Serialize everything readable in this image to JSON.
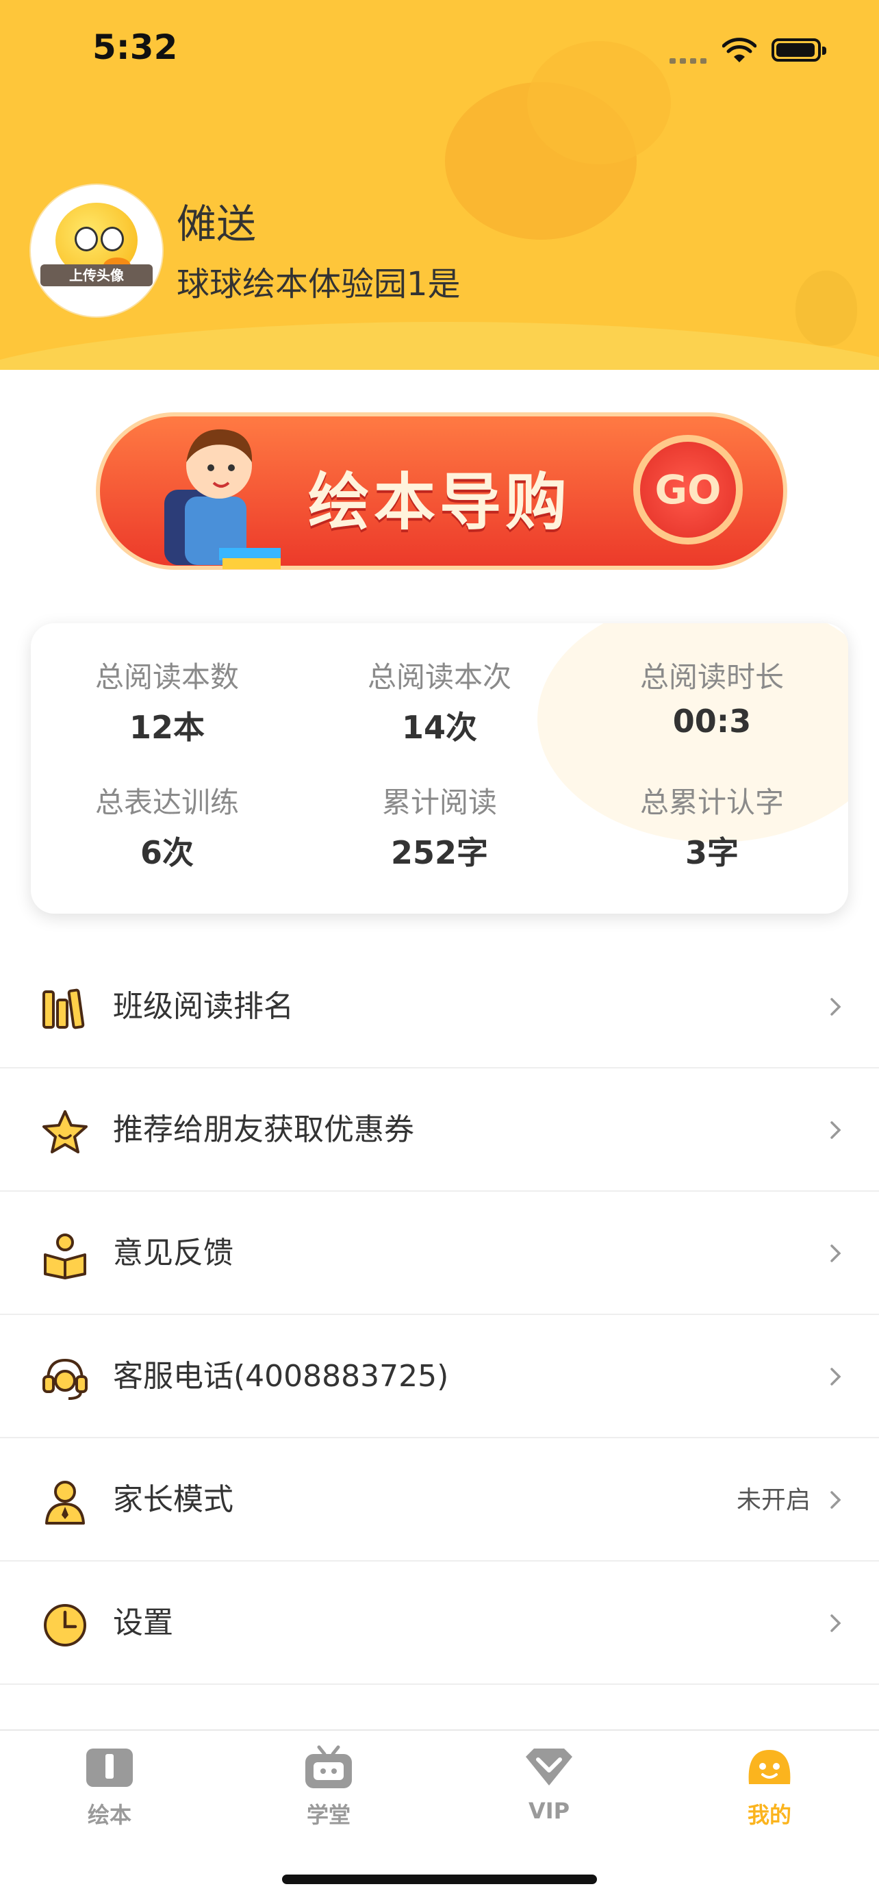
{
  "status_bar": {
    "time": "5:32"
  },
  "profile": {
    "name": "傩送",
    "school": "球球绘本体验园1是",
    "avatar_badge": "上传头像"
  },
  "banner": {
    "title": "绘本导购",
    "button": "GO"
  },
  "stats": [
    {
      "label": "总阅读本数",
      "value": "12本"
    },
    {
      "label": "总阅读本次",
      "value": "14次"
    },
    {
      "label": "总阅读时长",
      "value": "00:3"
    },
    {
      "label": "总表达训练",
      "value": "6次"
    },
    {
      "label": "累计阅读",
      "value": "252字"
    },
    {
      "label": "总累计认字",
      "value": "3字"
    }
  ],
  "menu": [
    {
      "label": "班级阅读排名",
      "icon": "books-icon",
      "extra": ""
    },
    {
      "label": "推荐给朋友获取优惠券",
      "icon": "star-icon",
      "extra": ""
    },
    {
      "label": "意见反馈",
      "icon": "reading-icon",
      "extra": ""
    },
    {
      "label": "客服电话(4008883725)",
      "icon": "headset-icon",
      "extra": ""
    },
    {
      "label": "家长模式",
      "icon": "parent-icon",
      "extra": "未开启"
    },
    {
      "label": "设置",
      "icon": "clock-icon",
      "extra": ""
    }
  ],
  "tabs": [
    {
      "label": "绘本",
      "icon": "book-icon",
      "active": false
    },
    {
      "label": "学堂",
      "icon": "tv-icon",
      "active": false
    },
    {
      "label": "VIP",
      "icon": "vip-icon",
      "active": false
    },
    {
      "label": "我的",
      "icon": "face-icon",
      "active": true
    }
  ],
  "colors": {
    "accent": "#fbb41e",
    "header": "#fec63a",
    "banner": "#ec3a2a"
  }
}
